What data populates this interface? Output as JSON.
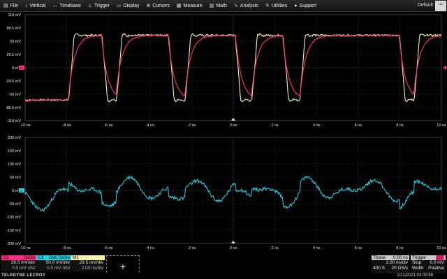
{
  "menu": [
    {
      "label": "File",
      "icon": "folder-icon",
      "glyph": "▤"
    },
    {
      "label": "Vertical",
      "icon": "vertical-arrows-icon",
      "glyph": "↕"
    },
    {
      "label": "Timebase",
      "icon": "horizontal-arrows-icon",
      "glyph": "↔"
    },
    {
      "label": "Trigger",
      "icon": "trigger-icon",
      "glyph": "⊥"
    },
    {
      "label": "Display",
      "icon": "display-icon",
      "glyph": "▭"
    },
    {
      "label": "Cursors",
      "icon": "cursors-icon",
      "glyph": "⊕"
    },
    {
      "label": "Measure",
      "icon": "measure-icon",
      "glyph": "▦"
    },
    {
      "label": "Math",
      "icon": "math-icon",
      "glyph": "▥"
    },
    {
      "label": "Analysis",
      "icon": "analysis-icon",
      "glyph": "∿"
    },
    {
      "label": "Utilities",
      "icon": "utilities-icon",
      "glyph": "✕"
    },
    {
      "label": "Support",
      "icon": "support-icon",
      "glyph": "●"
    }
  ],
  "preset": "Default",
  "logo_button": "Leo",
  "top_grid": {
    "y_labels": [
      "118 mV",
      "88.5 mV",
      "59 mV",
      "29.5 mV",
      "0 mV",
      "-29.5 mV",
      "-59 mV",
      "-88.5 mV",
      "-118 mV"
    ],
    "x_labels": [
      "-10 ns",
      "-8 ns",
      "-6 ns",
      "-4 ns",
      "-2 ns",
      "0 ns",
      "2 ns",
      "4 ns",
      "6 ns",
      "8 ns",
      "10 ns"
    ],
    "channel_marker": "C2"
  },
  "bottom_grid": {
    "y_labels": [
      "200 mV",
      "150 mV",
      "100 mV",
      "50 mV",
      "0 mV",
      "-50 mV",
      "-100 mV",
      "-150 mV",
      "-200 mV"
    ],
    "x_labels": [
      "-10 ns",
      "-8 ns",
      "-6 ns",
      "-4 ns",
      "-2 ns",
      "0 ns",
      "2 ns",
      "4 ns",
      "6 ns",
      "8 ns",
      "10 ns"
    ],
    "channel_marker": "C3"
  },
  "colors": {
    "c2": "#ff2d7e",
    "c3": "#21d4e6",
    "m1": "#f7f1b0",
    "grid": "#505050"
  },
  "channels": {
    "c2": {
      "name": "C2",
      "tag": "DeSe",
      "vdiv": "29.5 mV/div",
      "ofst": "0.0 mV ofst"
    },
    "c3": {
      "name": "C3",
      "tag": "Deb DeSe",
      "vdiv": "50.0 mV/div",
      "ofst": "0.0 mV ofst"
    },
    "m1": {
      "name": "M1",
      "vdiv": "29.5 mV/div",
      "tdiv": "2.00 ns/div"
    }
  },
  "add_button": "+",
  "timebase": {
    "title": "Tbase",
    "delay": "0.00 ns",
    "tdiv": "2.00 ns/div",
    "samples": "400 S",
    "rate": "20 GS/s"
  },
  "trigger": {
    "title": "Trigger",
    "tag": "C2",
    "mode": "Stop",
    "level": "0.0 mV",
    "type": "Width",
    "slope": "Positive"
  },
  "status": {
    "brand": "TELEDYNE LECROY",
    "datetime": "1/21/2021 03:00:59"
  }
}
